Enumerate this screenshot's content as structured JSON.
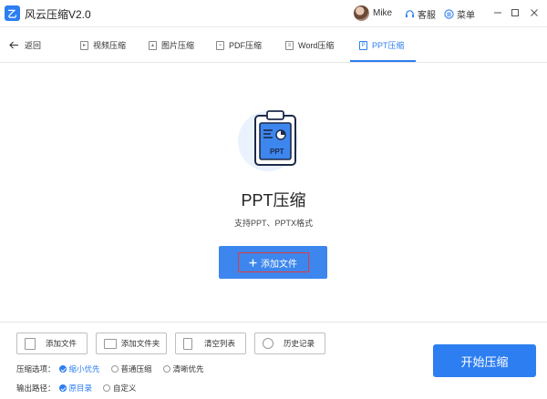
{
  "app": {
    "title": "风云压缩V2.0",
    "logo_glyph": "乙"
  },
  "header": {
    "user_name": "Mike",
    "kefu_label": "客服",
    "menu_label": "菜单"
  },
  "tabs": {
    "back_label": "返回",
    "items": [
      {
        "label": "视频压缩",
        "active": false
      },
      {
        "label": "图片压缩",
        "active": false
      },
      {
        "label": "PDF压缩",
        "active": false
      },
      {
        "label": "Word压缩",
        "active": false
      },
      {
        "label": "PPT压缩",
        "active": true
      }
    ]
  },
  "main": {
    "icon_text": "PPT",
    "title": "PPT压缩",
    "subtitle": "支持PPT、PPTX格式",
    "add_file_label": "添加文件"
  },
  "toolbar": {
    "add_file": "添加文件",
    "add_folder": "添加文件夹",
    "clear_list": "清空列表",
    "history": "历史记录"
  },
  "options": {
    "compress_label": "压缩选项：",
    "compress_items": [
      {
        "label": "缩小优先",
        "selected": true
      },
      {
        "label": "普通压缩",
        "selected": false
      },
      {
        "label": "清晰优先",
        "selected": false
      }
    ],
    "output_label": "输出路径：",
    "output_items": [
      {
        "label": "原目录",
        "selected": true
      },
      {
        "label": "自定义",
        "selected": false
      }
    ]
  },
  "start_label": "开始压缩",
  "colors": {
    "accent": "#2d7ef0",
    "highlight_border": "#e23b3b"
  }
}
